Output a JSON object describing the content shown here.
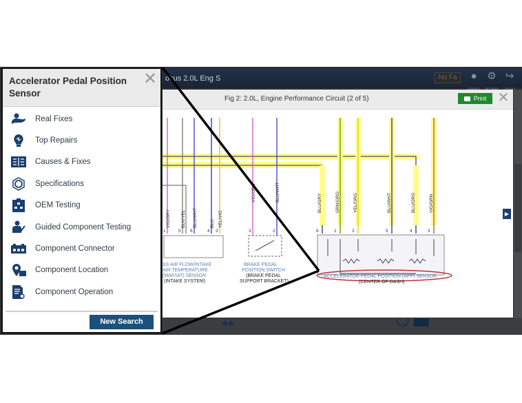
{
  "app": {
    "vehicle_breadcrumb": "ocus 2.0L Eng S",
    "no_favorites_label": "No Fa",
    "toolbar_icons": [
      {
        "name": "contact-icon",
        "caption": "CONTACT"
      },
      {
        "name": "settings-icon",
        "caption": "SETTINGS"
      },
      {
        "name": "logout-icon",
        "caption": "LOGOUT"
      }
    ]
  },
  "panel": {
    "title": "Accelerator Pedal Position Sensor",
    "close_glyph": "✕",
    "items": [
      {
        "label": "Real Fixes",
        "icon": "real-fixes-icon"
      },
      {
        "label": "Top Repairs",
        "icon": "top-repairs-icon"
      },
      {
        "label": "Causes & Fixes",
        "icon": "causes-fixes-icon"
      },
      {
        "label": "Specifications",
        "icon": "specifications-icon"
      },
      {
        "label": "OEM Testing",
        "icon": "oem-testing-icon"
      },
      {
        "label": "Guided Component Testing",
        "icon": "guided-testing-icon"
      },
      {
        "label": "Component Connector",
        "icon": "connector-icon"
      },
      {
        "label": "Component Location",
        "icon": "location-icon"
      },
      {
        "label": "Component Operation",
        "icon": "operation-icon"
      }
    ],
    "new_search_label": "New Search"
  },
  "modal": {
    "title": "Fig 2: 2.0L, Engine Performance Circuit (2 of 5)",
    "print_label": "Print",
    "close_glyph": "✕",
    "next_glyph": "▶"
  },
  "diagram": {
    "left_wires": [
      {
        "pin": "1",
        "code": "VIO/GRY",
        "color": "#d64fc8"
      },
      {
        "pin": "5",
        "code": "BLK/YEL",
        "color": "#7a7a6a"
      },
      {
        "pin": "6",
        "code": "BLU/WHT",
        "color": "#3a3ad0"
      },
      {
        "pin": "4",
        "code": "BLU",
        "color": "#2828c8"
      },
      {
        "pin": "3",
        "code": "YEL/VIO",
        "color": "#f0b030"
      }
    ],
    "maf_label": [
      "SS AIR FLOW/INTAKE",
      "AIR TEMPERATURE",
      "(MAF/IAT) SENSOR"
    ],
    "maf_location": "(INTAKE SYSTEM)",
    "brake_wires": [
      {
        "pin": "3",
        "code": "VIO/ORG",
        "color": "#d64fc8"
      },
      {
        "pin": "2",
        "code": "BLU/WHT",
        "color": "#3a3ad0"
      }
    ],
    "brake_label": [
      "BRAKE PEDAL",
      "POSITION SWITCH"
    ],
    "brake_location": [
      "(BRAKE PEDAL",
      "SUPPORT BRACKET)"
    ],
    "app_wires": [
      {
        "pin": "6",
        "code": "BLU/GRY",
        "color": "#4a4a8a"
      },
      {
        "pin": "1",
        "code": "GRN/ORG",
        "color": "#6aa020"
      },
      {
        "pin": "2",
        "code": "YEL/ORG",
        "color": "#e8d020"
      },
      {
        "pin": "5",
        "code": "BLU/WHT",
        "color": "#4a4a8a"
      },
      {
        "pin": "4",
        "code": "BLU/ORG",
        "color": "#4a4a8a"
      },
      {
        "pin": "3",
        "code": "VIO/GRN",
        "color": "#c86040"
      }
    ],
    "app_label": "ACCELERATOR PEDAL POSITION (APP) SENSOR",
    "app_location": "(CENTER OF DASH)",
    "colors": {
      "highlight": "#fffc8a",
      "label_blue": "#5a7fb8",
      "callout_red": "#c0303a"
    }
  },
  "colors": {
    "brand_blue": "#1b4f7c",
    "print_green": "#1e8a2e",
    "icon_navy": "#1b3f6e"
  }
}
